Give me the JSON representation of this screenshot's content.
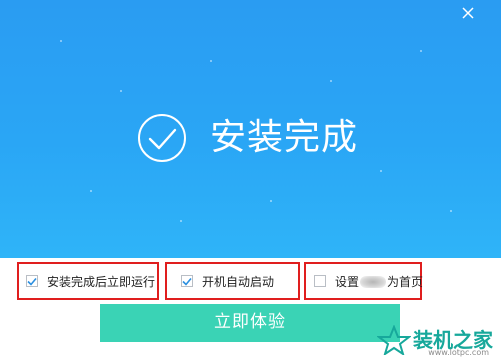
{
  "window": {
    "title": "安装完成",
    "close_icon": "close-icon"
  },
  "options": [
    {
      "label": "安装完成后立即运行",
      "checked": true
    },
    {
      "label": "开机自动启动",
      "checked": true
    },
    {
      "label_prefix": "设置",
      "label_suffix": "为首页",
      "checked": false
    }
  ],
  "cta": {
    "label": "立即体验"
  },
  "watermark": {
    "title": "装机之家",
    "url": "www.lotpc.com"
  },
  "colors": {
    "hero_top": "#2a9cf2",
    "hero_bottom": "#2fb4f8",
    "cta": "#3ad3b5",
    "highlight_border": "#e01e1e",
    "checkmark": "#2b8fe0"
  }
}
